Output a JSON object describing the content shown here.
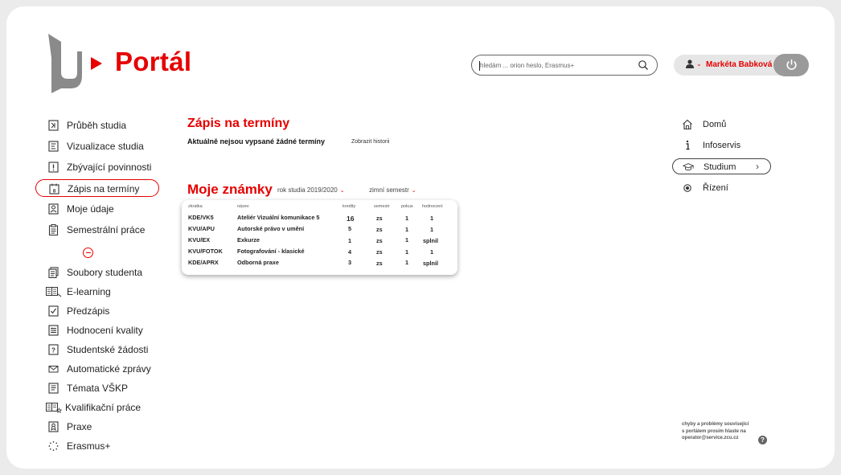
{
  "header": {
    "brand_title": "Portál",
    "search": {
      "placeholder": "hledám ... orion heslo, Erasmus+"
    },
    "user_name": "Markéta Babková"
  },
  "sidebar": {
    "items": [
      {
        "label": "Průběh studia",
        "icon": "progress-icon"
      },
      {
        "label": "Vizualizace studia",
        "icon": "visualization-icon"
      },
      {
        "label": "Zbývající povinnosti",
        "icon": "exclamation-box-icon"
      },
      {
        "label": "Zápis na termíny",
        "icon": "calendar-icon",
        "active": true
      },
      {
        "label": "Moje údaje",
        "icon": "id-card-icon"
      },
      {
        "label": "Semestrální práce",
        "icon": "clipboard-icon"
      },
      {
        "label": "Soubory studenta",
        "icon": "files-icon"
      },
      {
        "label": "E-learning",
        "icon": "elearning-icon"
      },
      {
        "label": "Předzápis",
        "icon": "checklist-icon"
      },
      {
        "label": "Hodnocení kvality",
        "icon": "rating-icon"
      },
      {
        "label": "Studentské žádosti",
        "icon": "question-box-icon"
      },
      {
        "label": "Automatické zprávy",
        "icon": "mail-icon"
      },
      {
        "label": "Témata VŠKP",
        "icon": "topics-icon"
      },
      {
        "label": "Kvalifikační práce",
        "icon": "thesis-icon"
      },
      {
        "label": "Praxe",
        "icon": "practice-icon"
      },
      {
        "label": "Erasmus+",
        "icon": "erasmus-stars-icon"
      }
    ]
  },
  "main": {
    "title": "Zápis na termíny",
    "note": "Aktuálně nejsou vypsané žádné termíny",
    "history_link": "Zobrazit historii",
    "grades": {
      "title": "Moje známky",
      "year_filter": "rok studia 2019/2020",
      "semester_filter": "zimní semestr",
      "columns": [
        "zkratka",
        "název",
        "kredity",
        "semestr",
        "pokus",
        "hodnocení"
      ],
      "rows": [
        [
          "KDE/VK5",
          "Ateliér Vizuální komunikace 5",
          "16",
          "zs",
          "1",
          "1"
        ],
        [
          "KVU/APU",
          "Autorské právo v umění",
          "5",
          "zs",
          "1",
          "1"
        ],
        [
          "KVU/EX",
          "Exkurze",
          "1",
          "zs",
          "1",
          "splnil"
        ],
        [
          "KVU/FOTOK",
          "Fotografování - klasické",
          "4",
          "zs",
          "1",
          "1"
        ],
        [
          "KDE/APRX",
          "Odborná praxe",
          "3",
          "zs",
          "1",
          "splnil"
        ]
      ]
    }
  },
  "right_nav": {
    "items": [
      {
        "label": "Domů",
        "icon": "home-icon"
      },
      {
        "label": "Infoservis",
        "icon": "info-icon"
      },
      {
        "label": "Studium",
        "icon": "graduation-cap-icon",
        "active": true,
        "arrow": "›"
      },
      {
        "label": "Řízení",
        "icon": "radio-dot-icon"
      }
    ]
  },
  "footer": {
    "lines": [
      "chyby a problémy související",
      "s portálem prosím hlaste na",
      "operator@service.zcu.cz"
    ],
    "help_symbol": "?"
  },
  "colors": {
    "accent": "#e60000",
    "text": "#222222",
    "muted": "#9a9a9a"
  }
}
